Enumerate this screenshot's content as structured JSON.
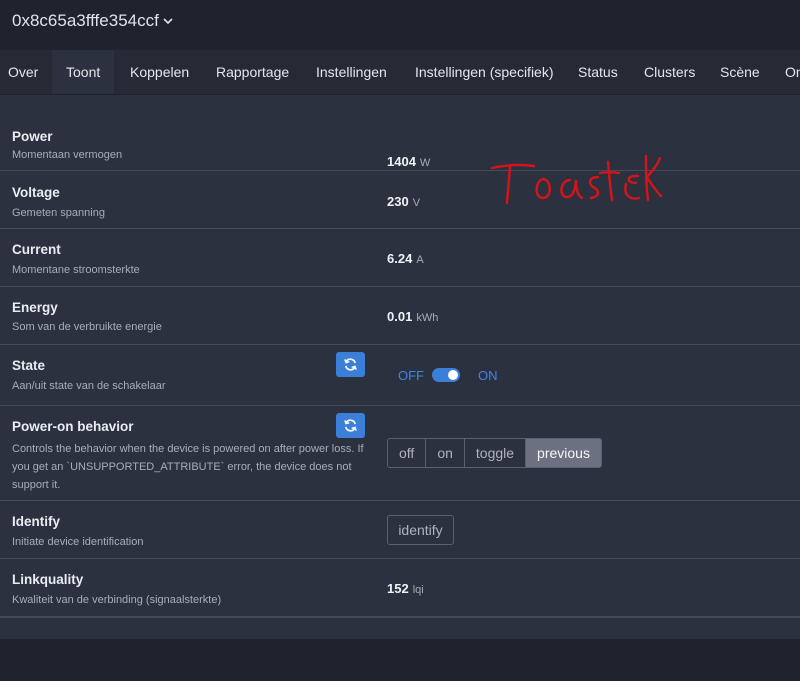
{
  "header": {
    "device_name": "0x8c65a3fffe354ccf"
  },
  "tabs": [
    {
      "label": "Over"
    },
    {
      "label": "Toont"
    },
    {
      "label": "Koppelen"
    },
    {
      "label": "Rapportage"
    },
    {
      "label": "Instellingen"
    },
    {
      "label": "Instellingen (specifiek)"
    },
    {
      "label": "Status"
    },
    {
      "label": "Clusters"
    },
    {
      "label": "Scène"
    },
    {
      "label": "On"
    }
  ],
  "active_tab": "Toont",
  "rows": {
    "power": {
      "label": "Power",
      "desc": "Momentaan vermogen",
      "value": "1404",
      "unit": "W"
    },
    "voltage": {
      "label": "Voltage",
      "desc": "Gemeten spanning",
      "value": "230",
      "unit": "V"
    },
    "current": {
      "label": "Current",
      "desc": "Momentane stroomsterkte",
      "value": "6.24",
      "unit": "A"
    },
    "energy": {
      "label": "Energy",
      "desc": "Som van de verbruikte energie",
      "value": "0.01",
      "unit": "kWh"
    },
    "state": {
      "label": "State",
      "desc": "Aan/uit state van de schakelaar",
      "off_label": "OFF",
      "on_label": "ON",
      "is_on": true
    },
    "power_on": {
      "label": "Power-on behavior",
      "desc": "Controls the behavior when the device is powered on after power loss. If you get an `UNSUPPORTED_ATTRIBUTE` error, the device does not support it.",
      "options": [
        "off",
        "on",
        "toggle",
        "previous"
      ],
      "selected": "previous"
    },
    "identify": {
      "label": "Identify",
      "desc": "Initiate device identification",
      "button": "identify"
    },
    "linkquality": {
      "label": "Linkquality",
      "desc": "Kwaliteit van de verbinding (signaalsterkte)",
      "value": "152",
      "unit": "lqi"
    }
  },
  "annotation": {
    "text": "Toaster",
    "color": "#d8121a"
  },
  "colors": {
    "accent": "#3c7fd9",
    "panel": "#2c3140",
    "background": "#1f232d"
  }
}
